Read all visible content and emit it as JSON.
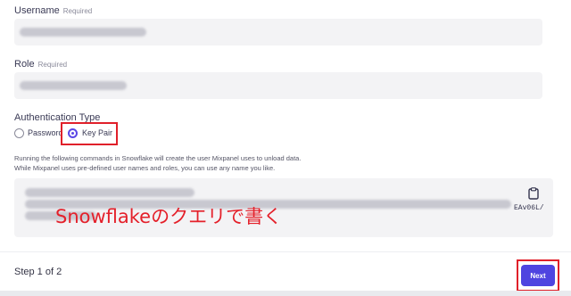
{
  "username": {
    "label": "Username",
    "required": "Required"
  },
  "role": {
    "label": "Role",
    "required": "Required"
  },
  "auth": {
    "label": "Authentication Type",
    "options": [
      "Password",
      "Key Pair"
    ],
    "selected": "Key Pair"
  },
  "help": {
    "line1": "Running the following commands in Snowflake will create the user Mixpanel uses to unload data.",
    "line2": "While Mixpanel uses pre-defined user names and roles, you can use any name you like."
  },
  "code": {
    "visible_tail": "EAv06L/"
  },
  "annotation": {
    "text": "Snowflakeのクエリで書く",
    "color": "#e4202a"
  },
  "footer": {
    "step": "Step 1 of 2",
    "next": "Next"
  },
  "colors": {
    "accent": "#4f44e0",
    "highlight": "#e0202a",
    "field_bg": "#f3f3f5"
  },
  "icons": {
    "copy": "clipboard-icon"
  }
}
